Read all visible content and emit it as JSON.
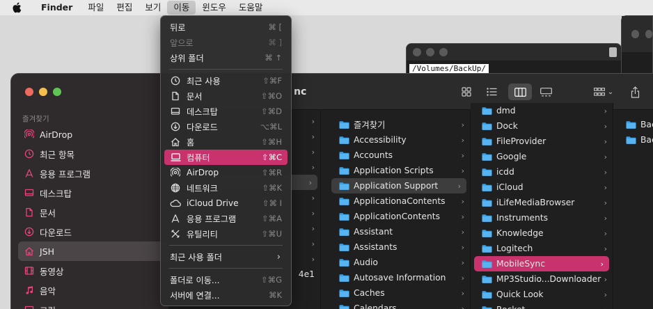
{
  "menubar": {
    "app": "Finder",
    "items": [
      "파일",
      "편집",
      "보기",
      "이동",
      "윈도우",
      "도움말"
    ]
  },
  "terminal": {
    "path": "/Volumes/BackUp/"
  },
  "finder": {
    "title_fragment": "nc",
    "sidebar_heading": "즐겨찾기",
    "sidebar_items": [
      {
        "label": "AirDrop",
        "icon": "airdrop-icon"
      },
      {
        "label": "최근 항목",
        "icon": "clock-icon"
      },
      {
        "label": "응용 프로그램",
        "icon": "applications-icon"
      },
      {
        "label": "데스크탑",
        "icon": "desktop-icon"
      },
      {
        "label": "문서",
        "icon": "document-icon"
      },
      {
        "label": "다운로드",
        "icon": "download-icon"
      },
      {
        "label": "JSH",
        "icon": "home-icon"
      },
      {
        "label": "동영상",
        "icon": "movies-icon"
      },
      {
        "label": "음악",
        "icon": "music-icon"
      },
      {
        "label": "그림",
        "icon": "pictures-icon"
      }
    ],
    "col1_fragment": "4e1",
    "col_library": [
      "즐겨찾기",
      "Accessibility",
      "Accounts",
      "Application Scripts",
      "Application Support",
      "ApplicationaContents",
      "ApplicationContents",
      "Assistant",
      "Assistants",
      "Audio",
      "Autosave Information",
      "Caches",
      "Calendars"
    ],
    "col_appsupport": [
      "dmd",
      "Dock",
      "FileProvider",
      "Google",
      "icdd",
      "iCloud",
      "iLifeMediaBrowser",
      "Instruments",
      "Knowledge",
      "Logitech",
      "MobileSync",
      "MP3Studio...Downloader",
      "Quick Look",
      "Rocket"
    ],
    "col_mobilesync": [
      "Bac",
      "Bac"
    ]
  },
  "gomenu": {
    "items": [
      {
        "label": "뒤로",
        "shortcut": "⌘ [",
        "disabled": false
      },
      {
        "label": "앞으로",
        "shortcut": "⌘ ]",
        "disabled": true
      },
      {
        "label": "상위 폴더",
        "shortcut": "⌘ ↑",
        "disabled": false
      }
    ],
    "places": [
      {
        "label": "최근 사용",
        "shortcut": "⇧⌘F",
        "icon": "clock-icon"
      },
      {
        "label": "문서",
        "shortcut": "⇧⌘O",
        "icon": "document-icon"
      },
      {
        "label": "데스크탑",
        "shortcut": "⇧⌘D",
        "icon": "desktop-icon"
      },
      {
        "label": "다운로드",
        "shortcut": "⌥⌘L",
        "icon": "download-icon"
      },
      {
        "label": "홈",
        "shortcut": "⇧⌘H",
        "icon": "home-icon"
      },
      {
        "label": "컴퓨터",
        "shortcut": "⇧⌘C",
        "icon": "computer-icon"
      },
      {
        "label": "AirDrop",
        "shortcut": "⇧⌘R",
        "icon": "airdrop-icon"
      },
      {
        "label": "네트워크",
        "shortcut": "⇧⌘K",
        "icon": "network-icon"
      },
      {
        "label": "iCloud Drive",
        "shortcut": "⇧⌘ I",
        "icon": "cloud-icon"
      },
      {
        "label": "응용 프로그램",
        "shortcut": "⇧⌘A",
        "icon": "applications-icon"
      },
      {
        "label": "유틸리티",
        "shortcut": "⇧⌘U",
        "icon": "utilities-icon"
      }
    ],
    "recent_folders": "최근 사용 폴더",
    "goto_folder": {
      "label": "폴더로 이동...",
      "shortcut": "⇧⌘G"
    },
    "connect_server": {
      "label": "서버에 연결...",
      "shortcut": "⌘K"
    }
  }
}
